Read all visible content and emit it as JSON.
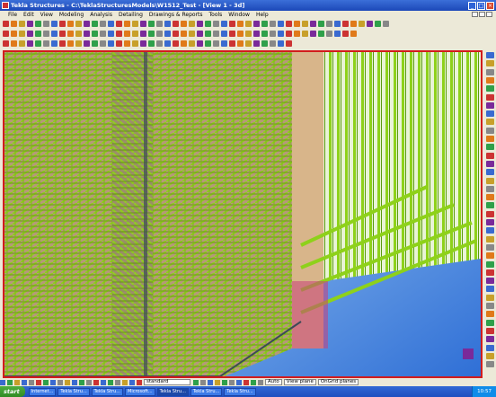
{
  "window": {
    "title": "Tekla Structures - C:\\TeklaStructuresModels\\W1512_Test - [View 1 - 3d]"
  },
  "menu": [
    "File",
    "Edit",
    "View",
    "Modeling",
    "Analysis",
    "Detailing",
    "Drawings & Reports",
    "Tools",
    "Window",
    "Help"
  ],
  "statusbar": {
    "standard_value": "standard",
    "auto_value": "Auto",
    "plane_select": "View plane",
    "snap_select": "OnGrid planes"
  },
  "taskbar": {
    "start_label": "start",
    "tasks": [
      "Internet...",
      "Tekla Stru...",
      "Tekla Stru...",
      "Microsoft...",
      "Tekla Stru...",
      "Tekla Stru...",
      "Tekla Stru..."
    ],
    "active_task_index": 4,
    "clock": "10:57"
  },
  "colors": {
    "accent": "#d21c1c",
    "rebar": "#8ed11a",
    "sky": "#6fa3e6"
  }
}
